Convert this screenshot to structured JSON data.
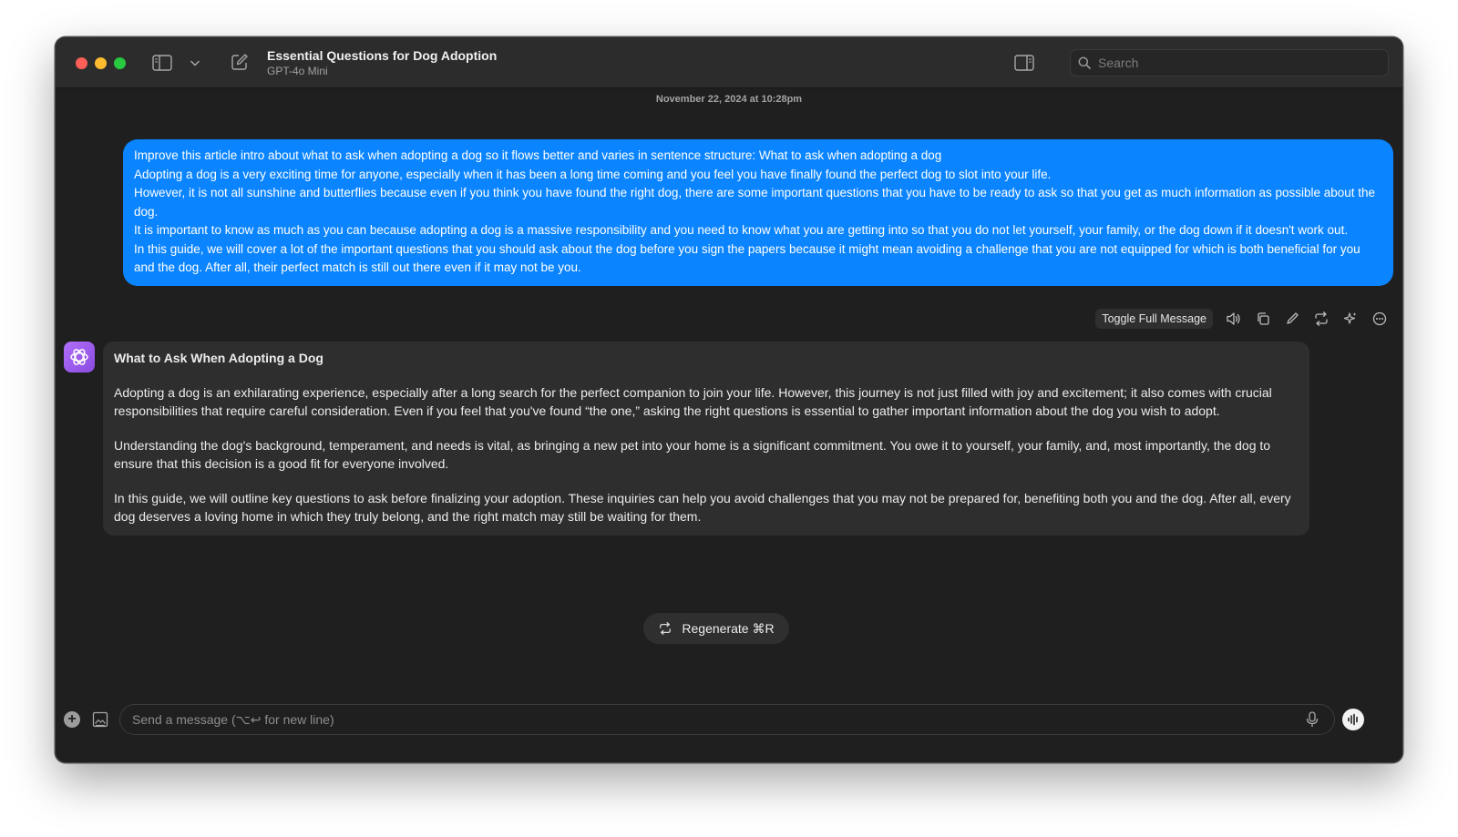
{
  "window": {
    "title": "Essential Questions for Dog Adoption",
    "model": "GPT-4o Mini"
  },
  "search": {
    "placeholder": "Search"
  },
  "timestamp": "November 22, 2024 at 10:28pm",
  "user_message": {
    "lines": [
      "Improve this article intro about what to ask when adopting a dog so it flows better and varies in sentence structure: What to ask when adopting a dog",
      "Adopting a dog is a very exciting time for anyone, especially when it has been a long time coming and you feel you have finally found the perfect dog to slot into your life.",
      "However, it is not all sunshine and butterflies because even if you think you have found the right dog, there are some important questions that you have to be ready to ask so that you get as much information as possible about the dog.",
      "It is important to know as much as you can because adopting a dog is a massive responsibility and you need to know what you are getting into so that you do not let yourself, your family, or the dog down if it doesn't work out.",
      "In this guide, we will cover a lot of the important questions that you should ask about the dog before you sign the papers because it might mean avoiding a challenge that you are not equipped for which is both beneficial for you and the dog. After all, their perfect match is still out there even if it may not be you."
    ]
  },
  "message_actions": {
    "toggle_label": "Toggle Full Message",
    "icons": [
      "speaker-icon",
      "copy-icon",
      "edit-icon",
      "retry-icon",
      "sparkle-icon",
      "more-icon"
    ]
  },
  "assistant_message": {
    "title": "What to Ask When Adopting a Dog",
    "paragraphs": [
      "Adopting a dog is an exhilarating experience, especially after a long search for the perfect companion to join your life. However, this journey is not just filled with joy and excitement; it also comes with crucial responsibilities that require careful consideration. Even if you feel that you've found “the one,” asking the right questions is essential to gather important information about the dog you wish to adopt.",
      "Understanding the dog's background, temperament, and needs is vital, as bringing a new pet into your home is a significant commitment. You owe it to yourself, your family, and, most importantly, the dog to ensure that this decision is a good fit for everyone involved.",
      "In this guide, we will outline key questions to ask before finalizing your adoption. These inquiries can help you avoid challenges that you may not be prepared for, benefiting both you and the dog. After all, every dog deserves a loving home in which they truly belong, and the right match may still be waiting for them."
    ]
  },
  "regenerate": {
    "label": "Regenerate ⌘R"
  },
  "composer": {
    "placeholder": "Send a message (⌥↩ for new line)",
    "value": ""
  },
  "colors": {
    "user_bubble": "#0a84ff",
    "assistant_bubble": "#2e2e2e",
    "window_bg": "#1f1f1f",
    "avatar": "#a25ef2"
  }
}
